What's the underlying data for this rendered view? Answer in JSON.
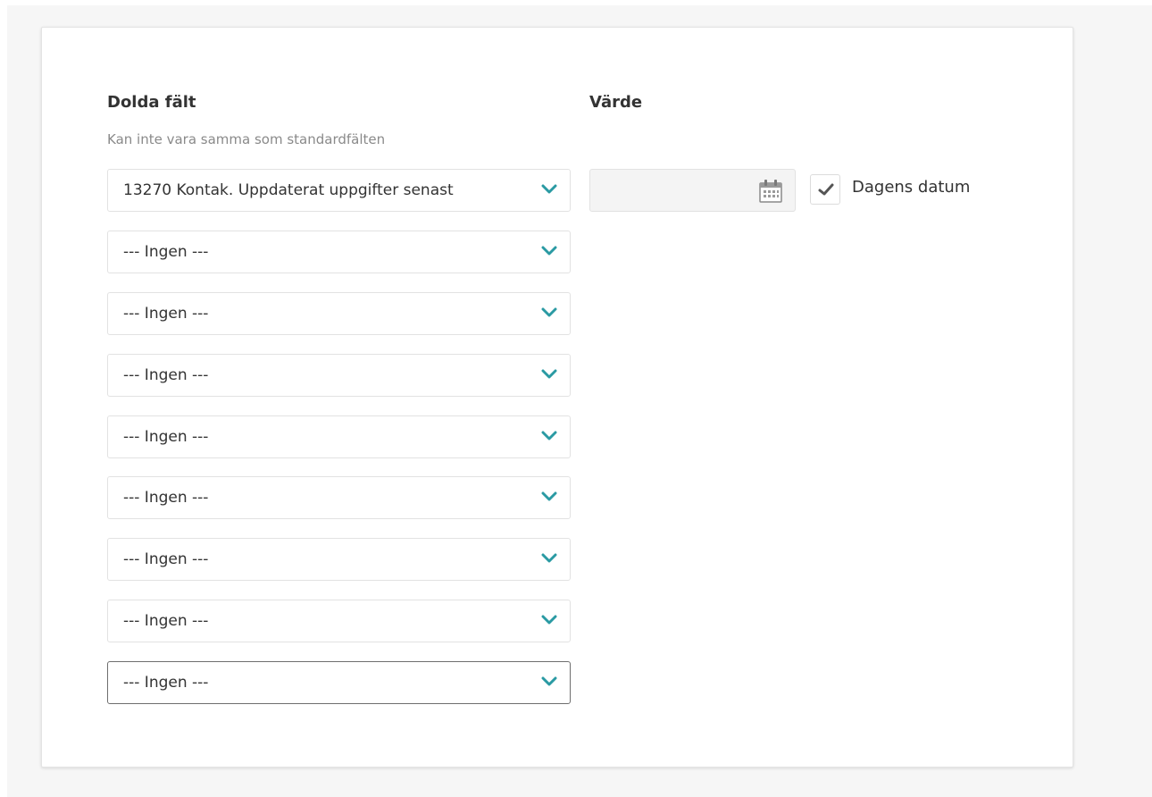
{
  "form": {
    "hidden_fields_heading": "Dolda fält",
    "value_heading": "Värde",
    "helper_text": "Kan inte vara samma som standardfälten",
    "selects": [
      {
        "value": "13270 Kontak. Uppdaterat uppgifter senast"
      },
      {
        "value": "--- Ingen ---"
      },
      {
        "value": "--- Ingen ---"
      },
      {
        "value": "--- Ingen ---"
      },
      {
        "value": "--- Ingen ---"
      },
      {
        "value": "--- Ingen ---"
      },
      {
        "value": "--- Ingen ---"
      },
      {
        "value": "--- Ingen ---"
      },
      {
        "value": "--- Ingen ---"
      }
    ],
    "date_input": {
      "value": "",
      "icon": "calendar-icon"
    },
    "today_checkbox": {
      "label": "Dagens datum",
      "checked": true
    }
  },
  "colors": {
    "accent": "#2a9aa3",
    "text": "#333333",
    "helper": "#8a8a8a",
    "border": "#e2e2e2",
    "background": "#f6f6f6"
  }
}
